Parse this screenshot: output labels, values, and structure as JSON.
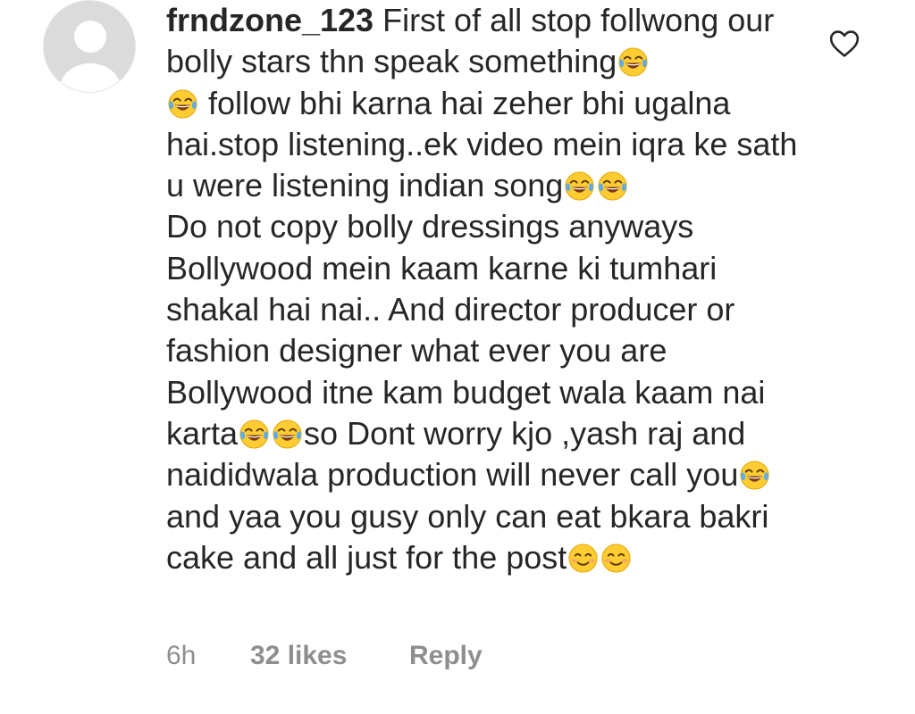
{
  "comment": {
    "username": "frndzone_123",
    "segments": [
      {
        "type": "text",
        "value": " First of all stop follwong our bolly stars thn speak something"
      },
      {
        "type": "emoji",
        "name": "tears-of-joy-emoji"
      },
      {
        "type": "text",
        "value": "\n"
      },
      {
        "type": "emoji",
        "name": "tears-of-joy-emoji"
      },
      {
        "type": "text",
        "value": " follow bhi karna hai zeher bhi ugalna hai.stop listening..ek video mein iqra ke sath u were listening indian song"
      },
      {
        "type": "emoji",
        "name": "tears-of-joy-emoji"
      },
      {
        "type": "emoji",
        "name": "tears-of-joy-emoji"
      },
      {
        "type": "text",
        "value": "\nDo not copy bolly dressings anyways Bollywood mein kaam karne ki tumhari shakal hai nai.. And director producer or fashion designer what ever you are Bollywood itne kam budget wala kaam nai karta"
      },
      {
        "type": "emoji",
        "name": "tears-of-joy-emoji"
      },
      {
        "type": "emoji",
        "name": "tears-of-joy-emoji"
      },
      {
        "type": "text",
        "value": "so Dont worry kjo ,yash raj and naididwala production will never call you"
      },
      {
        "type": "emoji",
        "name": "tears-of-joy-emoji"
      },
      {
        "type": "text",
        "value": "and yaa you gusy only can eat bkara bakri cake and all just for the post"
      },
      {
        "type": "emoji",
        "name": "smiling-face-emoji"
      },
      {
        "type": "emoji",
        "name": "smiling-face-emoji"
      }
    ]
  },
  "meta": {
    "time": "6h",
    "likes": "32 likes",
    "reply": "Reply"
  },
  "icons": {
    "avatar": "default-avatar-icon",
    "like": "heart-outline-icon"
  },
  "colors": {
    "text": "#262626",
    "meta": "#8e8e8e",
    "avatar_bg": "#dbdbdb"
  }
}
